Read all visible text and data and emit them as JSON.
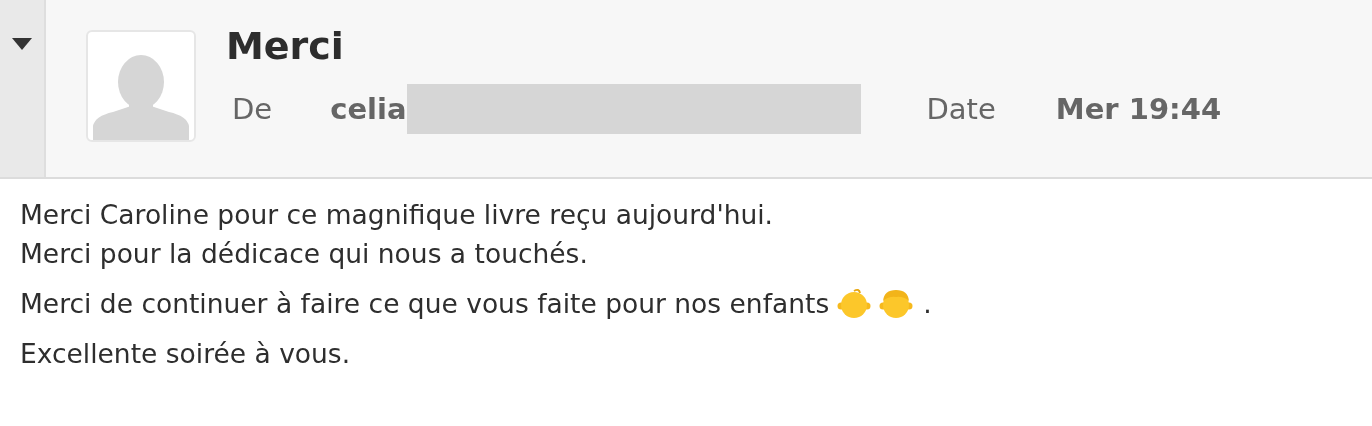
{
  "header": {
    "expanded": true,
    "subject": "Merci",
    "from_label": "De",
    "from_value": "celia",
    "date_label": "Date",
    "date_value": "Mer 19:44"
  },
  "body": {
    "lines": [
      {
        "text": "Merci Caroline pour ce magnifique livre reçu aujourd'hui."
      },
      {
        "text": "Merci pour la dédicace qui nous a touchés."
      },
      {
        "text": "Merci de continuer à faire ce que vous faite pour nos enfants",
        "icons": [
          {
            "kind": "baby"
          },
          {
            "kind": "boy"
          }
        ],
        "after": "."
      },
      {
        "text": "Excellente soirée à vous."
      }
    ]
  }
}
